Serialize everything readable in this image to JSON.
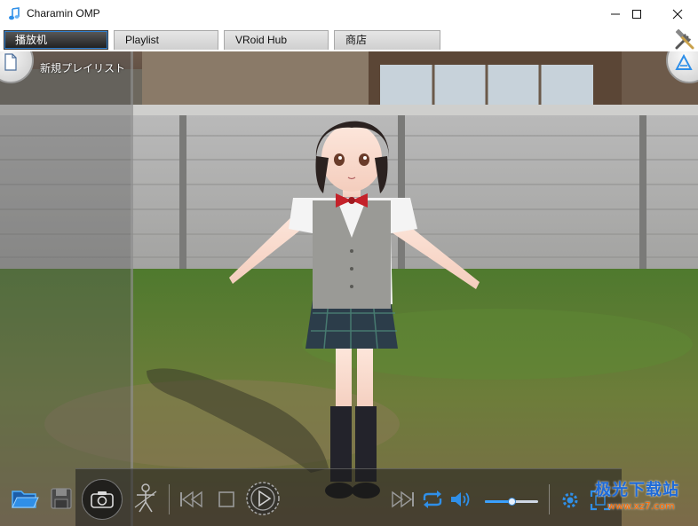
{
  "window": {
    "title": "Charamin OMP",
    "icon": "music-note-icon"
  },
  "tabs": [
    {
      "label": "播放机",
      "active": true
    },
    {
      "label": "Playlist",
      "active": false
    },
    {
      "label": "VRoid Hub",
      "active": false
    },
    {
      "label": "商店",
      "active": false
    }
  ],
  "sidebar": {
    "new_playlist_label": "新規プレイリスト"
  },
  "controls": {
    "items": [
      "open-folder-icon",
      "save-icon",
      "camera-icon",
      "pose-icon",
      "previous-icon",
      "stop-icon",
      "play-icon",
      "next-icon",
      "repeat-icon",
      "volume-icon",
      "settings-icon",
      "fullscreen-icon"
    ],
    "volume_level": 0.5
  },
  "watermark": {
    "text": "极光下载站",
    "url": "www.xz7.com"
  },
  "colors": {
    "accent": "#2f8fe8",
    "tab_active_bg": "#2a2a2a"
  }
}
